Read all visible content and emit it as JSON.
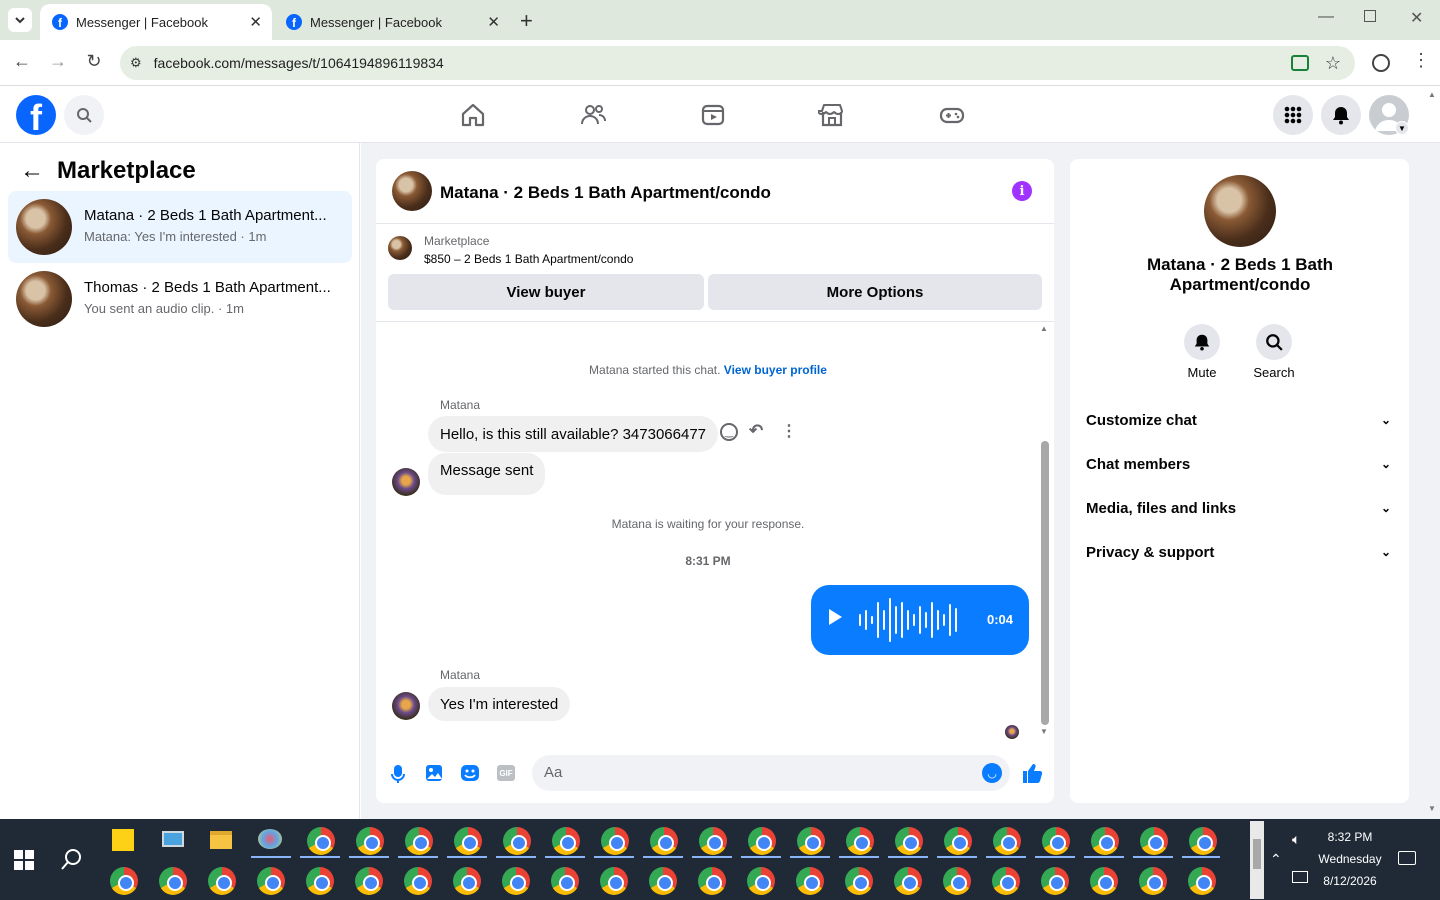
{
  "browser": {
    "tabs": [
      {
        "title": "Messenger | Facebook",
        "active": true
      },
      {
        "title": "Messenger | Facebook",
        "active": false
      }
    ],
    "url": "facebook.com/messages/t/1064194896119834"
  },
  "header": {
    "nav_icons": [
      "home-icon",
      "friends-icon",
      "video-icon",
      "marketplace-icon",
      "gaming-icon"
    ]
  },
  "sidebar": {
    "title": "Marketplace",
    "conversations": [
      {
        "title": "Matana · 2 Beds 1 Bath Apartment...",
        "preview": "Matana: Yes I'm interested · 1m",
        "selected": true
      },
      {
        "title": "Thomas · 2 Beds 1 Bath Apartment...",
        "preview": "You sent an audio clip. · 1m",
        "selected": false
      }
    ]
  },
  "chat": {
    "title": "Matana · 2 Beds 1 Bath Apartment/condo",
    "listing": {
      "label": "Marketplace",
      "detail": "$850 – 2 Beds 1 Bath Apartment/condo",
      "view_buyer": "View buyer",
      "more_options": "More Options"
    },
    "started_text": "Matana started this chat.",
    "buyer_profile_link": "View buyer profile",
    "sender_name": "Matana",
    "msg1": "Hello, is this still available? 3473066477",
    "msg2": "Message sent",
    "waiting_text": "Matana is waiting for your response.",
    "timestamp": "8:31 PM",
    "audio_duration": "0:04",
    "sender_name2": "Matana",
    "msg3": "Yes I'm interested",
    "composer_placeholder": "Aa"
  },
  "info_panel": {
    "title": "Matana · 2 Beds 1 Bath Apartment/condo",
    "mute": "Mute",
    "search": "Search",
    "sections": [
      "Customize chat",
      "Chat members",
      "Media, files and links",
      "Privacy & support"
    ]
  },
  "taskbar": {
    "time": "8:32 PM",
    "day": "Wednesday",
    "date": "8/12/2026"
  },
  "colors": {
    "accent": "#0866ff",
    "messenger_blue": "#0a7cff",
    "info_purple": "#a033ff"
  }
}
